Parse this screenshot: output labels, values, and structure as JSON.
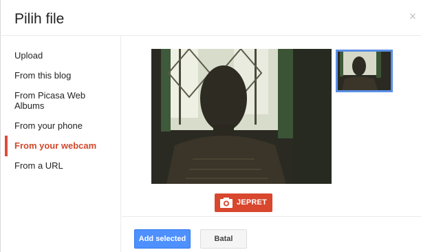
{
  "dialog": {
    "title": "Pilih file",
    "close_icon": "close-icon",
    "close_glyph": "×"
  },
  "sidebar": {
    "items": [
      {
        "label": "Upload",
        "active": false
      },
      {
        "label": "From this blog",
        "active": false
      },
      {
        "label": "From Picasa Web Albums",
        "active": false
      },
      {
        "label": "From your phone",
        "active": false
      },
      {
        "label": "From your webcam",
        "active": true
      },
      {
        "label": "From a URL",
        "active": false
      }
    ]
  },
  "main": {
    "snapshot_button_label": "JEPRET",
    "snapshot_icon": "camera-icon"
  },
  "footer": {
    "primary_label": "Add selected",
    "cancel_label": "Batal"
  },
  "colors": {
    "accent_red": "#dd4b39",
    "primary_blue": "#4d90fe",
    "thumb_border": "#5a8fe6"
  }
}
